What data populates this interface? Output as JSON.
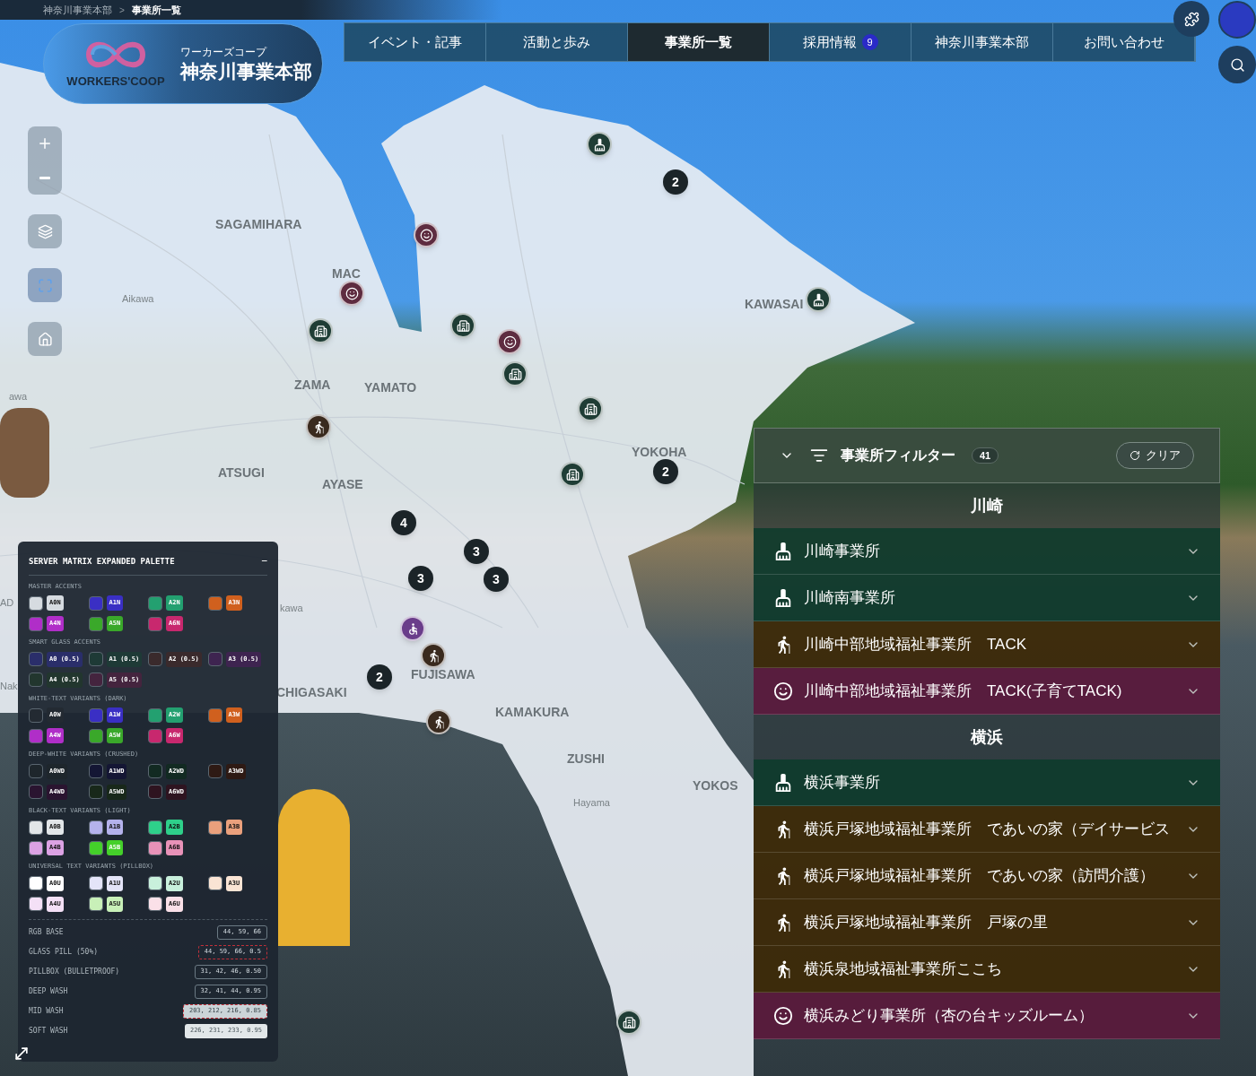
{
  "breadcrumb": [
    "神奈川事業本部",
    ">",
    "事業所一覧"
  ],
  "logo": {
    "kana": "ワーカーズコープ",
    "title": "神奈川事業本部",
    "wordmark": "WORKERS'COOP"
  },
  "nav": [
    {
      "label": "イベント・記事",
      "selected": false
    },
    {
      "label": "活動と歩み",
      "selected": false
    },
    {
      "label": "事業所一覧",
      "selected": true
    },
    {
      "label": "採用情報",
      "selected": false,
      "badge": "9"
    },
    {
      "label": "神奈川事業本部",
      "selected": false
    },
    {
      "label": "お問い合わせ",
      "selected": false
    }
  ],
  "map_labels": [
    {
      "text": "SAGAMIHARA",
      "kind": "city"
    },
    {
      "text": "MAC",
      "kind": "city"
    },
    {
      "text": "Aikawa",
      "kind": "town"
    },
    {
      "text": "ZAMA",
      "kind": "city"
    },
    {
      "text": "YAMATO",
      "kind": "city"
    },
    {
      "text": "KAWASAI",
      "kind": "city"
    },
    {
      "text": "ATSUGI",
      "kind": "city"
    },
    {
      "text": "AYASE",
      "kind": "city"
    },
    {
      "text": "YOKOHA",
      "kind": "city"
    },
    {
      "text": "FUJISAWA",
      "kind": "city"
    },
    {
      "text": "CHIGASAKI",
      "kind": "city"
    },
    {
      "text": "KAMAKURA",
      "kind": "city"
    },
    {
      "text": "ZUSHI",
      "kind": "city"
    },
    {
      "text": "YOKOS",
      "kind": "city"
    },
    {
      "text": "Hayama",
      "kind": "town"
    },
    {
      "text": "kawa",
      "kind": "town"
    },
    {
      "text": "AD",
      "kind": "town"
    },
    {
      "text": "Nak",
      "kind": "town"
    },
    {
      "text": "awa",
      "kind": "town"
    }
  ],
  "markers": [
    {
      "kind": "broom"
    },
    {
      "kind": "cluster",
      "count": "2"
    },
    {
      "kind": "smile"
    },
    {
      "kind": "smile"
    },
    {
      "kind": "building"
    },
    {
      "kind": "building"
    },
    {
      "kind": "smile"
    },
    {
      "kind": "building"
    },
    {
      "kind": "broom"
    },
    {
      "kind": "building"
    },
    {
      "kind": "walker"
    },
    {
      "kind": "building"
    },
    {
      "kind": "cluster",
      "count": "2"
    },
    {
      "kind": "cluster",
      "count": "4"
    },
    {
      "kind": "cluster",
      "count": "3"
    },
    {
      "kind": "cluster",
      "count": "3"
    },
    {
      "kind": "cluster",
      "count": "3"
    },
    {
      "kind": "wheelchair"
    },
    {
      "kind": "walker"
    },
    {
      "kind": "cluster",
      "count": "2"
    },
    {
      "kind": "walker"
    },
    {
      "kind": "building"
    }
  ],
  "palette": {
    "title": "SERVER MATRIX EXPANDED PALETTE",
    "collapse": "−",
    "sections": [
      {
        "title": "MASTER ACCENTS",
        "items": [
          {
            "label": "A0N",
            "color": "#d6dbe0"
          },
          {
            "label": "A1N",
            "color": "#3a2fc4"
          },
          {
            "label": "A2N",
            "color": "#23a070"
          },
          {
            "label": "A3N",
            "color": "#d0601e"
          },
          {
            "label": "A4N",
            "color": "#b02ec8"
          },
          {
            "label": "A5N",
            "color": "#3aa82a"
          },
          {
            "label": "A6N",
            "color": "#c8286e"
          }
        ]
      },
      {
        "title": "SMART GLASS ACCENTS",
        "items": [
          {
            "label": "A0 (0.5)",
            "color": "#2a2e6a"
          },
          {
            "label": "A1 (0.5)",
            "color": "#1e3a36"
          },
          {
            "label": "A2 (0.5)",
            "color": "#3a2a2c"
          },
          {
            "label": "A3 (0.5)",
            "color": "#3e2450"
          },
          {
            "label": "A4 (0.5)",
            "color": "#22362e"
          },
          {
            "label": "A5 (0.5)",
            "color": "#44243e"
          }
        ]
      },
      {
        "title": "WHITE-TEXT VARIANTS (DARK)",
        "items": [
          {
            "label": "A0W",
            "color": "#232a32"
          },
          {
            "label": "A1W",
            "color": "#3a2fc4"
          },
          {
            "label": "A2W",
            "color": "#23a070"
          },
          {
            "label": "A3W",
            "color": "#d0601e"
          },
          {
            "label": "A4W",
            "color": "#b02ec8"
          },
          {
            "label": "A5W",
            "color": "#3aa82a"
          },
          {
            "label": "A6W",
            "color": "#c8286e"
          }
        ]
      },
      {
        "title": "DEEP-WHITE VARIANTS (CRUSHED)",
        "items": [
          {
            "label": "A0WD",
            "color": "#1e262c"
          },
          {
            "label": "A1WD",
            "color": "#141634"
          },
          {
            "label": "A2WD",
            "color": "#122a22"
          },
          {
            "label": "A3WD",
            "color": "#2e1a14"
          },
          {
            "label": "A4WD",
            "color": "#2a1430"
          },
          {
            "label": "A5WD",
            "color": "#18281a"
          },
          {
            "label": "A6WD",
            "color": "#2e1420"
          }
        ]
      },
      {
        "title": "BLACK-TEXT VARIANTS (LIGHT)",
        "items": [
          {
            "label": "A0B",
            "color": "#e2e6e8"
          },
          {
            "label": "A1B",
            "color": "#b4b2ec"
          },
          {
            "label": "A2B",
            "color": "#2ed08a"
          },
          {
            "label": "A3B",
            "color": "#eaa07c"
          },
          {
            "label": "A4B",
            "color": "#dca2e4"
          },
          {
            "label": "A5B",
            "color": "#44d02a"
          },
          {
            "label": "A6B",
            "color": "#e892b8"
          }
        ]
      },
      {
        "title": "UNIVERSAL TEXT VARIANTS (PILLBOX)",
        "items": [
          {
            "label": "A0U",
            "color": "#ffffff"
          },
          {
            "label": "A1U",
            "color": "#e4e4f8"
          },
          {
            "label": "A2U",
            "color": "#c8f0dc"
          },
          {
            "label": "A3U",
            "color": "#fae4d4"
          },
          {
            "label": "A4U",
            "color": "#f4e0f6"
          },
          {
            "label": "A5U",
            "color": "#c8f0b8"
          },
          {
            "label": "A6U",
            "color": "#fae0e8"
          }
        ]
      }
    ],
    "values": [
      {
        "label": "RGB BASE",
        "value": "44, 59, 66",
        "kind": "outline"
      },
      {
        "label": "GLASS PILL (50%)",
        "value": "44, 59, 66, 0.5",
        "kind": "dashed"
      },
      {
        "label": "PILLBOX (BULLETPROOF)",
        "value": "31, 42, 46, 0.50",
        "kind": "outline"
      },
      {
        "label": "DEEP WASH",
        "value": "32, 41, 44, 0.95",
        "kind": "outline"
      },
      {
        "label": "MID WASH",
        "value": "203, 212, 216, 0.85",
        "kind": "dashed_light"
      },
      {
        "label": "SOFT WASH",
        "value": "226, 231, 233, 0.95",
        "kind": "light"
      }
    ]
  },
  "filter": {
    "title": "事業所フィルター",
    "count": "41",
    "clear": "クリア",
    "groups": [
      {
        "name": "川崎",
        "items": [
          {
            "kind": "broom",
            "name": "川崎事業所"
          },
          {
            "kind": "broom",
            "name": "川崎南事業所"
          },
          {
            "kind": "walker",
            "name": "川崎中部地域福祉事業所　TACK"
          },
          {
            "kind": "smile",
            "name": "川崎中部地域福祉事業所　TACK(子育てTACK)"
          }
        ]
      },
      {
        "name": "横浜",
        "items": [
          {
            "kind": "broom",
            "name": "横浜事業所"
          },
          {
            "kind": "walker",
            "name": "横浜戸塚地域福祉事業所　であいの家（デイサービス"
          },
          {
            "kind": "walker",
            "name": "横浜戸塚地域福祉事業所　であいの家（訪問介護）"
          },
          {
            "kind": "walker",
            "name": "横浜戸塚地域福祉事業所　戸塚の里"
          },
          {
            "kind": "walker",
            "name": "横浜泉地域福祉事業所ここち"
          },
          {
            "kind": "smile",
            "name": "横浜みどり事業所（杏の台キッズルーム）"
          }
        ]
      }
    ]
  }
}
